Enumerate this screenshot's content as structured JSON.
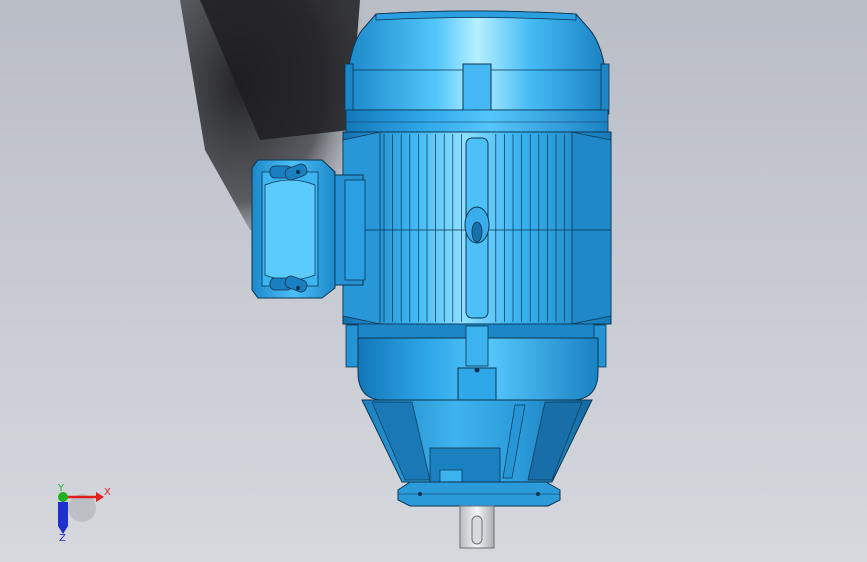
{
  "viewport": {
    "background_top": "#b8bcc5",
    "background_bottom": "#d4d6dc"
  },
  "model": {
    "body_color": "#2aa3e6",
    "highlight_color": "#8fe0ff",
    "shadow_color": "#0f5f96",
    "line_color": "#0a3550",
    "shaft_color": "#e6e9ee"
  },
  "triad": {
    "x_label": "X",
    "y_label": "Y",
    "z_label": "Z",
    "x_color": "#e02020",
    "y_color": "#20b020",
    "z_color": "#2030d0"
  }
}
